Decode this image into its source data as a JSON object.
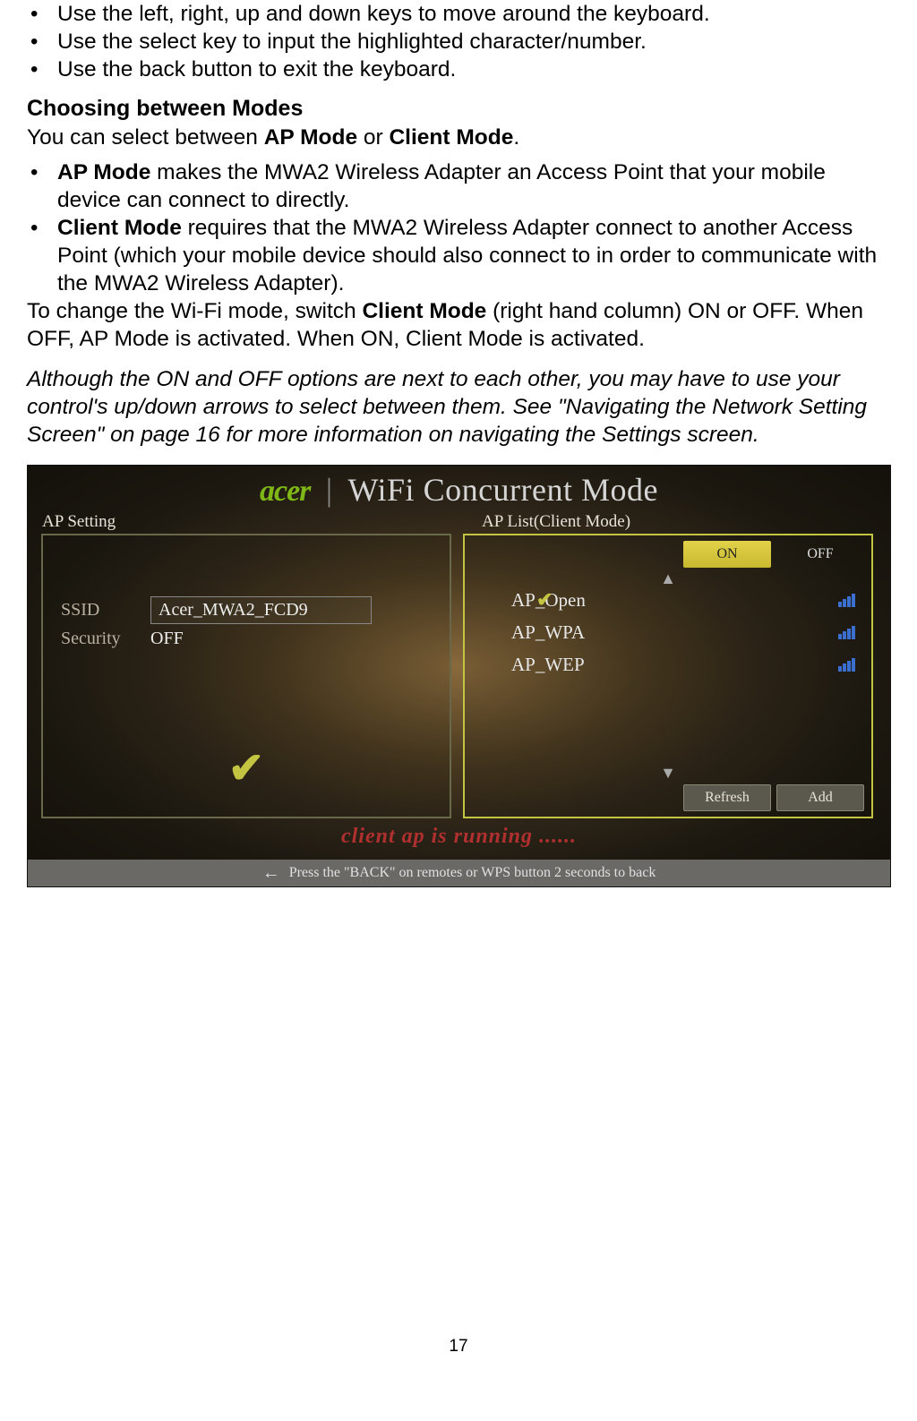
{
  "bullets_top": [
    "Use the left, right, up and down keys to move around the keyboard.",
    "Use the select key to input the highlighted character/number.",
    "Use the back button to exit the keyboard."
  ],
  "section_heading": "Choosing between Modes",
  "intro_a": "You can select between ",
  "intro_b": "AP Mode",
  "intro_c": " or ",
  "intro_d": "Client Mode",
  "intro_e": ".",
  "mode_bullets": [
    {
      "bold": "AP Mode",
      "rest": " makes the MWA2 Wireless Adapter an Access Point that your mobile device can connect to directly."
    },
    {
      "bold": "Client Mode",
      "rest": " requires that the MWA2 Wireless Adapter connect to another Access Point (which your mobile device should also connect to in order to communicate with the MWA2 Wireless Adapter)."
    }
  ],
  "change_a": "To change the Wi-Fi mode, switch ",
  "change_b": "Client Mode",
  "change_c": " (right hand column) ON or OFF. When OFF, AP Mode is activated. When ON, Client Mode is activated.",
  "note": "Although the ON and OFF options are next to each other, you may have to use your control's up/down arrows to select between them. See \"Navigating the Network Setting Screen\" on page 16 for more information on navigating the Settings screen.",
  "page_number": "17",
  "screenshot": {
    "brand": "acer",
    "title": "WiFi Concurrent Mode",
    "left": {
      "heading": "AP Setting",
      "ssid_label": "SSID",
      "ssid_value": "Acer_MWA2_FCD9",
      "security_label": "Security",
      "security_value": "OFF"
    },
    "right": {
      "heading": "AP List(Client Mode)",
      "on": "ON",
      "off": "OFF",
      "items": [
        "AP_Open",
        "AP_WPA",
        "AP_WEP"
      ],
      "refresh": "Refresh",
      "add": "Add"
    },
    "status": "client ap is running ......",
    "help": "Press the \"BACK\" on remotes or WPS button 2 seconds to back"
  }
}
